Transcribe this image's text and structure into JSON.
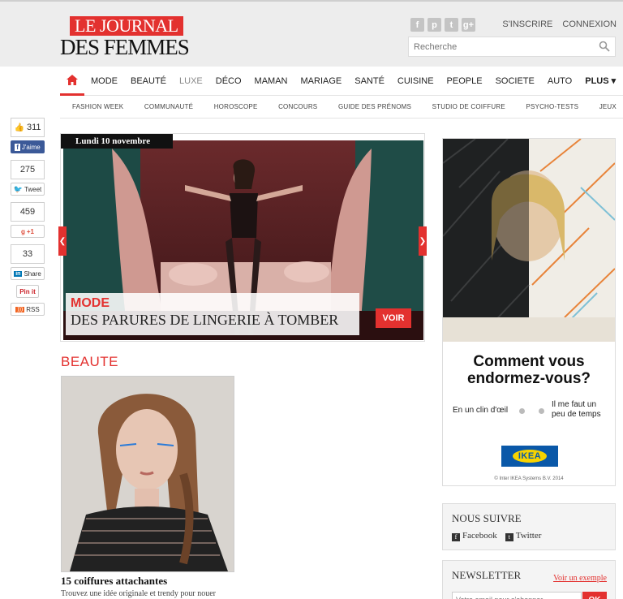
{
  "header": {
    "logo_top": "LE JOURNAL",
    "logo_bottom": "DES FEMMES",
    "socials": [
      "f",
      "p",
      "t",
      "g+"
    ],
    "signup": "S'INSCRIRE",
    "login": "CONNEXION",
    "search_placeholder": "Recherche"
  },
  "nav": {
    "items": [
      "MODE",
      "BEAUTÉ",
      "LUXE",
      "DÉCO",
      "MAMAN",
      "MARIAGE",
      "SANTÉ",
      "CUISINE",
      "PEOPLE",
      "SOCIETE",
      "AUTO"
    ],
    "more": "PLUS ▾"
  },
  "subnav": [
    "FASHION WEEK",
    "COMMUNAUTÉ",
    "HOROSCOPE",
    "CONCOURS",
    "GUIDE DES PRÉNOMS",
    "STUDIO DE COIFFURE",
    "PSYCHO-TESTS",
    "JEUX"
  ],
  "share": {
    "like_count": "311",
    "like_label": "J'aime",
    "tweet_count": "275",
    "tweet_label": "Tweet",
    "gplus_count": "459",
    "gplus_label": "+1",
    "linkedin_count": "33",
    "linkedin_label": "Share",
    "pinit_label": "Pin it",
    "rss_label": "RSS"
  },
  "hero": {
    "date": "Lundi 10 novembre",
    "category": "MODE",
    "title": "DES PARURES DE LINGERIE À TOMBER",
    "cta": "VOIR"
  },
  "beaute": {
    "section": "BEAUTE",
    "article_title": "15 coiffures attachantes",
    "article_desc": "Trouvez une idée originale et trendy pour nouer"
  },
  "ad": {
    "question": "Comment vous endormez-vous?",
    "option1": "En un clin d'œil",
    "option2": "Il me faut un peu de temps",
    "brand": "IKEA",
    "copyright": "© Inter IKEA Systems B.V. 2014"
  },
  "follow": {
    "title": "NOUS SUIVRE",
    "facebook": "Facebook",
    "twitter": "Twitter"
  },
  "newsletter": {
    "title": "NEWSLETTER",
    "example": "Voir un exemple",
    "placeholder": "Votre email pour s'abonner",
    "ok": "OK"
  },
  "colors": {
    "accent": "#e3312f",
    "facebook": "#3b5998",
    "twitter": "#55acee",
    "linkedin": "#0077b5"
  }
}
